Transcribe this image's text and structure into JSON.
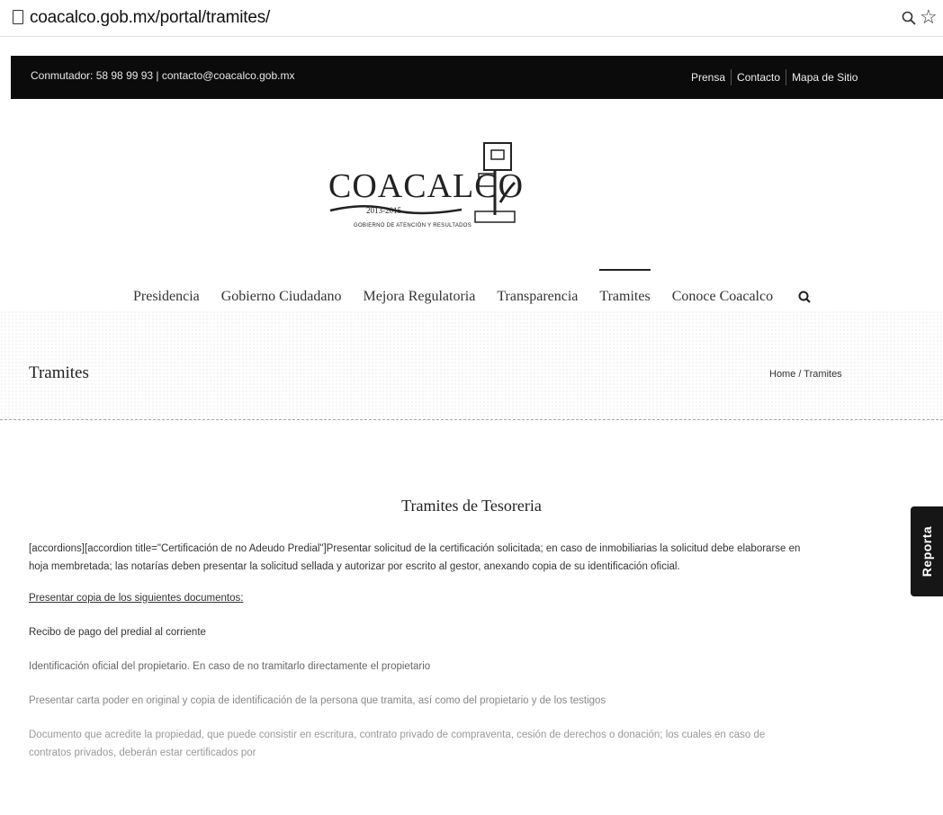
{
  "browser": {
    "url": "coacalco.gob.mx/portal/tramites/"
  },
  "topbar": {
    "contact": "Conmutador: 58 98 99 93  |  contacto@coacalco.gob.mx",
    "links": [
      "Prensa",
      "Contacto",
      "Mapa de Sitio"
    ]
  },
  "logo": {
    "name": "COACALCO",
    "years": "2013-2015",
    "tagline": "GOBIERNO DE ATENCIÓN Y RESULTADOS"
  },
  "nav": {
    "items": [
      "Presidencia",
      "Gobierno Ciudadano",
      "Mejora Regulatoria",
      "Transparencia",
      "Tramites",
      "Conoce Coacalco"
    ],
    "active": "Tramites"
  },
  "page": {
    "title": "Tramites",
    "breadcrumb": "Home / Tramites"
  },
  "content": {
    "section_title": "Tramites de Tesoreria",
    "paragraphs": [
      "[accordions][accordion title=\"Certificación de no Adeudo Predial\"]Presentar solicitud de la certificación solicitada; en caso de inmobiliarias la solicitud debe elaborarse en hoja membretada; las notarías deben presentar la solicitud sellada y autorizar por escrito al gestor, anexando copia de su identificación oficial.",
      "Presentar copia de los siguientes documentos:",
      "Recibo de pago del predial al corriente",
      "Identificación oficial del propietario. En caso de no tramitarlo directamente el propietario",
      "Presentar carta poder en original y copia de identificación de la persona que tramita, así como del propietario y de los testigos",
      "Documento que acredite la propiedad, que puede consistir en escritura, contrato privado de compraventa, cesión de derechos o donación; los cuales en caso de contratos privados, deberán estar certificados por"
    ]
  },
  "feedback_tab": "Reporta"
}
